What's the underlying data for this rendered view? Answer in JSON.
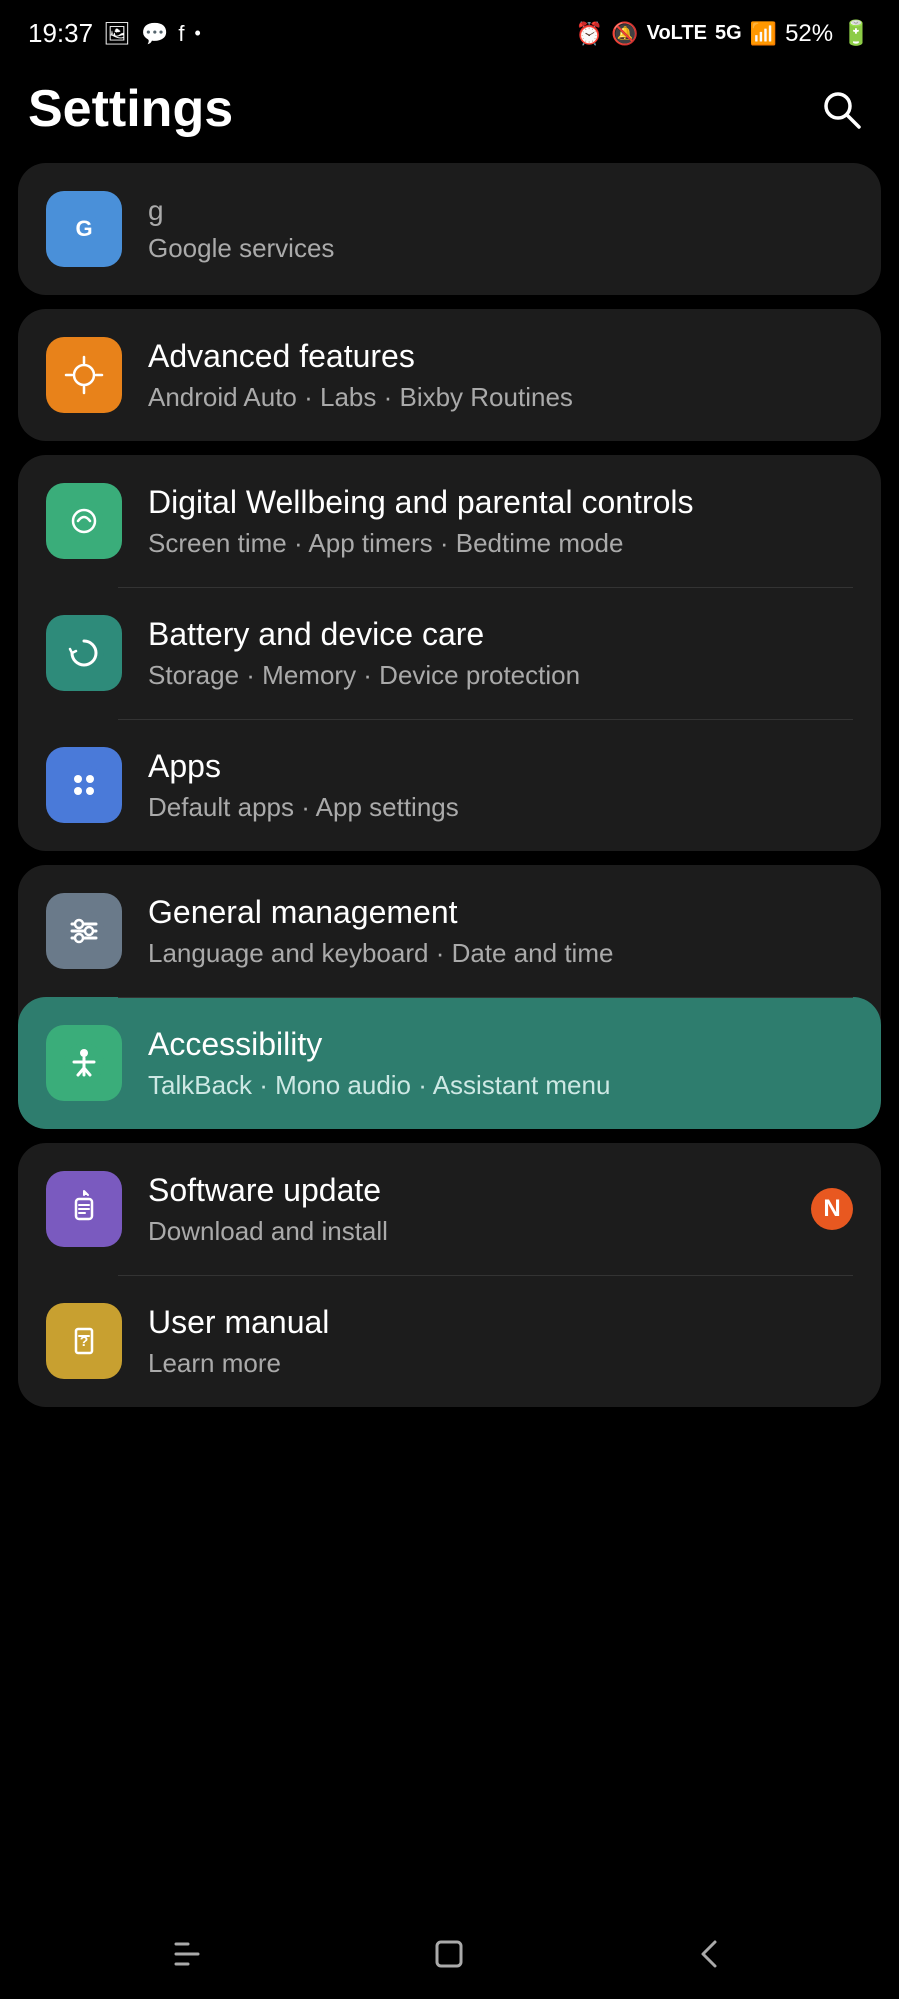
{
  "statusBar": {
    "time": "19:37",
    "batteryPercent": "52%"
  },
  "header": {
    "title": "Settings",
    "searchLabel": "Search"
  },
  "settingsGroups": [
    {
      "id": "group1",
      "items": [
        {
          "id": "google-services",
          "title": "Google services",
          "subtitle": "",
          "iconColor": "icon-blue",
          "iconType": "google",
          "highlighted": false,
          "badge": null
        }
      ]
    },
    {
      "id": "group2",
      "items": [
        {
          "id": "advanced-features",
          "title": "Advanced features",
          "subtitle": "Android Auto · Labs · Bixby Routines",
          "iconColor": "icon-orange",
          "iconType": "gear-star",
          "highlighted": false,
          "badge": null
        }
      ]
    },
    {
      "id": "group3",
      "items": [
        {
          "id": "digital-wellbeing",
          "title": "Digital Wellbeing and parental controls",
          "subtitle": "Screen time · App timers · Bedtime mode",
          "iconColor": "icon-green",
          "iconType": "heart-circle",
          "highlighted": false,
          "badge": null
        },
        {
          "id": "battery-care",
          "title": "Battery and device care",
          "subtitle": "Storage · Memory · Device protection",
          "iconColor": "icon-teal",
          "iconType": "refresh-circle",
          "highlighted": false,
          "badge": null
        },
        {
          "id": "apps",
          "title": "Apps",
          "subtitle": "Default apps · App settings",
          "iconColor": "icon-blue-apps",
          "iconType": "apps-grid",
          "highlighted": false,
          "badge": null
        }
      ]
    },
    {
      "id": "group4",
      "items": [
        {
          "id": "general-management",
          "title": "General management",
          "subtitle": "Language and keyboard · Date and time",
          "iconColor": "icon-gray",
          "iconType": "sliders",
          "highlighted": false,
          "badge": null
        },
        {
          "id": "accessibility",
          "title": "Accessibility",
          "subtitle": "TalkBack · Mono audio · Assistant menu",
          "iconColor": "icon-green-acc",
          "iconType": "accessibility",
          "highlighted": true,
          "badge": null
        }
      ]
    },
    {
      "id": "group5",
      "items": [
        {
          "id": "software-update",
          "title": "Software update",
          "subtitle": "Download and install",
          "iconColor": "icon-purple",
          "iconType": "update",
          "highlighted": false,
          "badge": "N"
        },
        {
          "id": "user-manual",
          "title": "User manual",
          "subtitle": "Learn more",
          "iconColor": "icon-yellow",
          "iconType": "manual",
          "highlighted": false,
          "badge": null
        }
      ]
    }
  ],
  "bottomNav": {
    "recentLabel": "Recent apps",
    "homeLabel": "Home",
    "backLabel": "Back"
  }
}
